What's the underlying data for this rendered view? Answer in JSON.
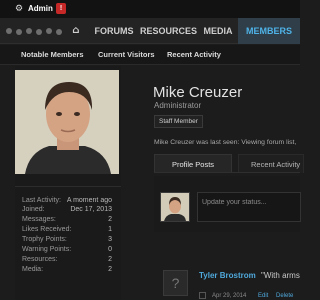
{
  "admin_bar": {
    "label": "Admin",
    "alert": "!"
  },
  "nav": {
    "tabs": [
      "FORUMS",
      "RESOURCES",
      "MEDIA",
      "MEMBERS"
    ],
    "active_tab": "MEMBERS",
    "active_color": "#4fb3e8"
  },
  "subnav": {
    "links": [
      "Notable Members",
      "Current Visitors",
      "Recent Activity"
    ]
  },
  "profile": {
    "name": "Mike Creuzer",
    "title": "Administrator",
    "badge": "Staff Member",
    "last_seen": "Mike Creuzer was last seen: Viewing forum list,"
  },
  "stats": [
    {
      "label": "Last Activity:",
      "value": "A moment ago"
    },
    {
      "label": "Joined:",
      "value": "Dec 17, 2013"
    },
    {
      "label": "Messages:",
      "value": "2"
    },
    {
      "label": "Likes Received:",
      "value": "1"
    },
    {
      "label": "Trophy Points:",
      "value": "3"
    },
    {
      "label": "Warning Points:",
      "value": "0"
    },
    {
      "label": "Resources:",
      "value": "2"
    },
    {
      "label": "Media:",
      "value": "2"
    }
  ],
  "tabs": {
    "posts": "Profile Posts",
    "activity": "Recent Activity"
  },
  "status": {
    "placeholder": "Update your status..."
  },
  "feed": {
    "author": "Tyler Brostrom",
    "quote": "\"With arms",
    "date": "Apr 29, 2014",
    "edit": "Edit",
    "delete": "Delete"
  }
}
